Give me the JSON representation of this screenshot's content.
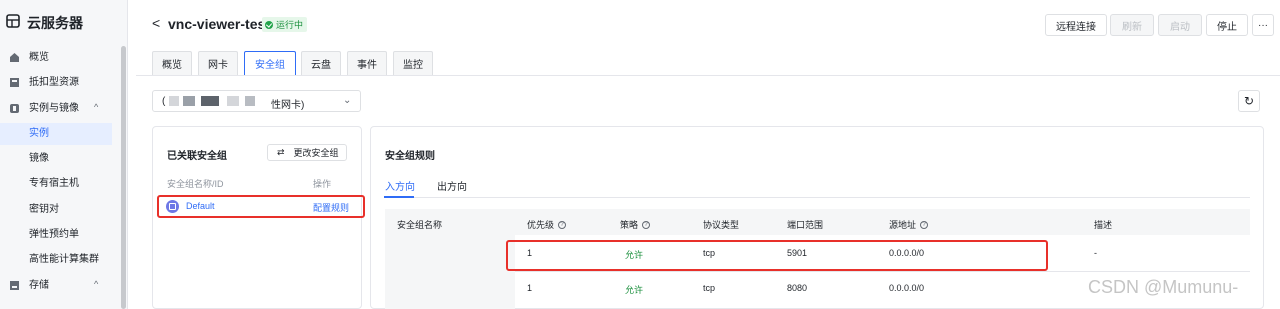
{
  "sidebar": {
    "brand": "云服务器",
    "items": [
      {
        "label": "概览"
      },
      {
        "label": "抵扣型资源"
      },
      {
        "label": "实例与镜像"
      },
      {
        "label": "存储"
      }
    ],
    "subitems": [
      {
        "label": "实例"
      },
      {
        "label": "镜像"
      },
      {
        "label": "专有宿主机"
      },
      {
        "label": "密钥对"
      },
      {
        "label": "弹性预约单"
      },
      {
        "label": "高性能计算集群"
      }
    ]
  },
  "header": {
    "back": "<",
    "title": "vnc-viewer-test",
    "status": "运行中",
    "buttons": {
      "remote": "远程连接",
      "refresh": "刷新",
      "start": "启动",
      "stop": "停止",
      "more": "···"
    }
  },
  "tabs": [
    "概览",
    "网卡",
    "安全组",
    "云盘",
    "事件",
    "监控"
  ],
  "nic_select": {
    "prefix": "(",
    "suffix": "性网卡)"
  },
  "left_panel": {
    "title": "已关联安全组",
    "change_button": "更改安全组",
    "col_name": "安全组名称/ID",
    "col_action": "操作",
    "group_name": "Default",
    "group_action": "配置规则"
  },
  "right_panel": {
    "title": "安全组规则",
    "tab_in": "入方向",
    "tab_out": "出方向",
    "headers": {
      "name": "安全组名称",
      "priority": "优先级",
      "policy": "策略",
      "protocol": "协议类型",
      "port": "端口范围",
      "source": "源地址",
      "desc": "描述"
    },
    "rows": [
      {
        "priority": "1",
        "policy": "允许",
        "protocol": "tcp",
        "port": "5901",
        "source": "0.0.0.0/0",
        "desc": "-"
      },
      {
        "priority": "1",
        "policy": "允许",
        "protocol": "tcp",
        "port": "8080",
        "source": "0.0.0.0/0",
        "desc": ""
      }
    ]
  },
  "watermark": "CSDN @Mumunu-",
  "colors": {
    "accent": "#2f6cf6",
    "success": "#1a8f3c",
    "highlight": "#e8302a"
  }
}
